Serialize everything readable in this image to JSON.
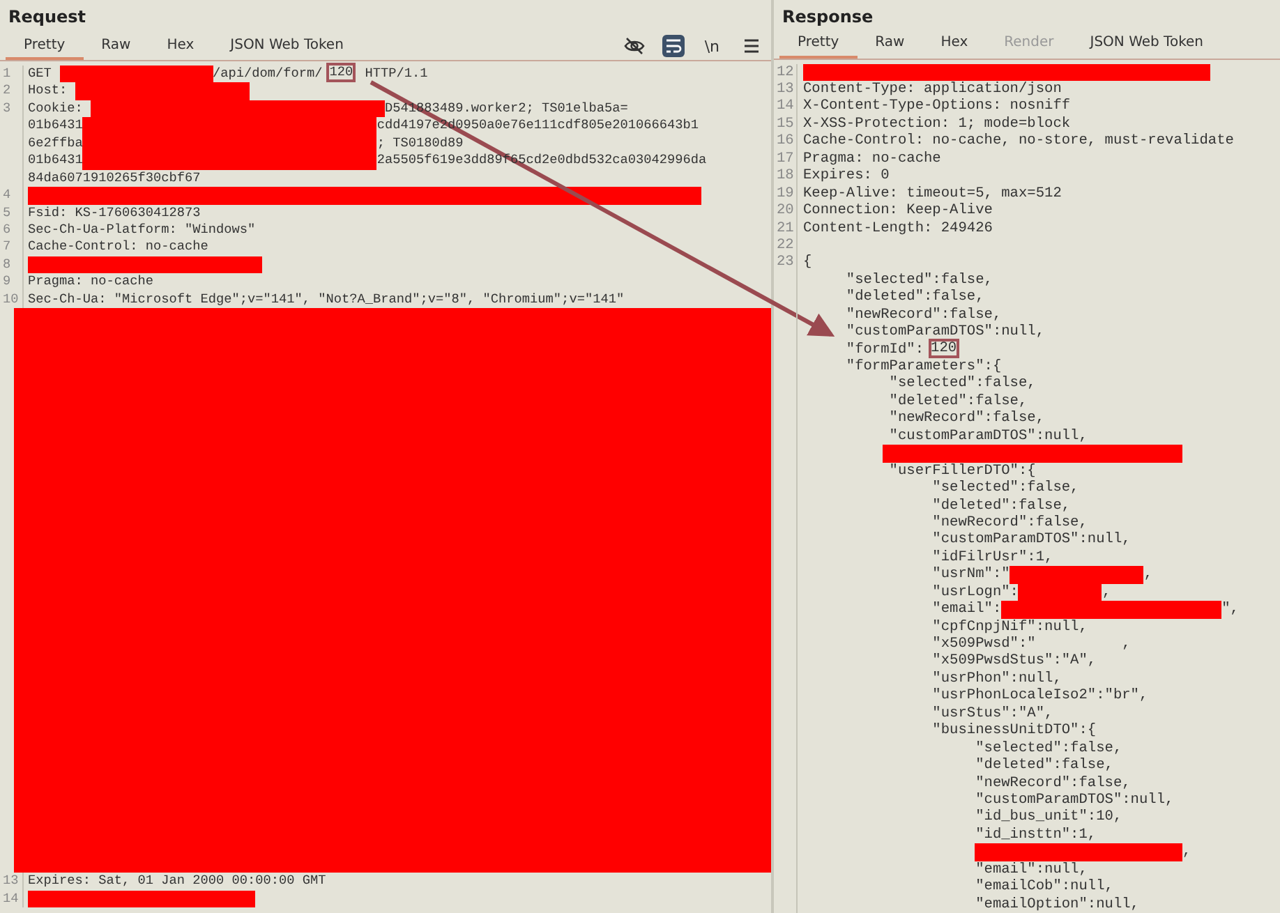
{
  "request": {
    "title": "Request",
    "tabs": [
      {
        "label": "Pretty",
        "selected": true,
        "disabled": false
      },
      {
        "label": "Raw",
        "selected": false,
        "disabled": false
      },
      {
        "label": "Hex",
        "selected": false,
        "disabled": false
      },
      {
        "label": "JSON Web Token",
        "selected": false,
        "disabled": false
      }
    ],
    "toolbar": {
      "wrap_on": true,
      "newline_label": "\\n"
    },
    "lines": [
      {
        "number": "1",
        "parts": [
          {
            "kind": "text",
            "text": "GET "
          },
          {
            "kind": "redaction"
          },
          {
            "kind": "text",
            "text": "/api/dom/form/"
          },
          {
            "kind": "highlight",
            "text": "120"
          },
          {
            "kind": "text",
            "text": " HTTP/1.1"
          }
        ]
      },
      {
        "number": "2",
        "parts": [
          {
            "kind": "text",
            "text": "Host: "
          },
          {
            "kind": "redaction"
          }
        ]
      },
      {
        "number": "3",
        "parts": [
          {
            "kind": "text",
            "text": "Cookie: "
          },
          {
            "kind": "redaction"
          },
          {
            "kind": "text",
            "text": "D541883489.worker2; TS01elba5a="
          }
        ]
      },
      {
        "parts": [
          {
            "kind": "text",
            "text": "01b6431"
          },
          {
            "kind": "redaction"
          },
          {
            "kind": "text",
            "text": "cdd4197e2d0950a0e76e111cdf805e201066643b1"
          }
        ]
      },
      {
        "parts": [
          {
            "kind": "text",
            "text": "6e2ffba"
          },
          {
            "kind": "redaction"
          },
          {
            "kind": "text",
            "text": "; TS0180d89"
          }
        ]
      },
      {
        "parts": [
          {
            "kind": "text",
            "text": "01b6431"
          },
          {
            "kind": "redaction"
          },
          {
            "kind": "text",
            "text": "2a5505f619e3dd89f65cd2e0dbd532ca03042996da"
          }
        ]
      },
      {
        "parts": [
          {
            "kind": "text",
            "text": "84da6071910265f30cbf67"
          }
        ]
      },
      {
        "number": "4",
        "parts": [
          {
            "kind": "redaction"
          }
        ]
      },
      {
        "number": "5",
        "parts": [
          {
            "kind": "text",
            "text": "Fsid: KS-1760630412873"
          }
        ]
      },
      {
        "number": "6",
        "parts": [
          {
            "kind": "text",
            "text": "Sec-Ch-Ua-Platform: \"Windows\""
          }
        ]
      },
      {
        "number": "7",
        "parts": [
          {
            "kind": "text",
            "text": "Cache-Control: no-cache"
          }
        ]
      },
      {
        "number": "8",
        "parts": [
          {
            "kind": "redaction"
          }
        ]
      },
      {
        "number": "9",
        "parts": [
          {
            "kind": "text",
            "text": "Pragma: no-cache"
          }
        ]
      },
      {
        "number": "10",
        "parts": [
          {
            "kind": "text",
            "text": "Sec-Ch-Ua: \"Microsoft Edge\";v=\"141\", \"Not?A_Brand\";v=\"8\", \"Chromium\";v=\"141\""
          }
        ]
      },
      {
        "parts": [
          {
            "kind": "block"
          }
        ]
      },
      {
        "number": "13",
        "parts": [
          {
            "kind": "text",
            "text": "Expires: Sat, 01 Jan 2000 00:00:00 GMT"
          }
        ]
      },
      {
        "number": "14",
        "parts": [
          {
            "kind": "redaction"
          }
        ]
      }
    ]
  },
  "response": {
    "title": "Response",
    "tabs": [
      {
        "label": "Pretty",
        "selected": true,
        "disabled": false
      },
      {
        "label": "Raw",
        "selected": false,
        "disabled": false
      },
      {
        "label": "Hex",
        "selected": false,
        "disabled": false
      },
      {
        "label": "Render",
        "selected": false,
        "disabled": true
      },
      {
        "label": "JSON Web Token",
        "selected": false,
        "disabled": false
      }
    ],
    "lines": [
      {
        "number": "12",
        "parts": [
          {
            "kind": "redaction"
          }
        ]
      },
      {
        "number": "13",
        "parts": [
          {
            "kind": "text",
            "text": "Content-Type: application/json"
          }
        ]
      },
      {
        "number": "14",
        "parts": [
          {
            "kind": "text",
            "text": "X-Content-Type-Options: nosniff"
          }
        ]
      },
      {
        "number": "15",
        "parts": [
          {
            "kind": "text",
            "text": "X-XSS-Protection: 1; mode=block"
          }
        ]
      },
      {
        "number": "16",
        "parts": [
          {
            "kind": "text",
            "text": "Cache-Control: no-cache, no-store, must-revalidate"
          }
        ]
      },
      {
        "number": "17",
        "parts": [
          {
            "kind": "text",
            "text": "Pragma: no-cache"
          }
        ]
      },
      {
        "number": "18",
        "parts": [
          {
            "kind": "text",
            "text": "Expires: 0"
          }
        ]
      },
      {
        "number": "19",
        "parts": [
          {
            "kind": "text",
            "text": "Keep-Alive: timeout=5, max=512"
          }
        ]
      },
      {
        "number": "20",
        "parts": [
          {
            "kind": "text",
            "text": "Connection: Keep-Alive"
          }
        ]
      },
      {
        "number": "21",
        "parts": [
          {
            "kind": "text",
            "text": "Content-Length: 249426"
          }
        ]
      },
      {
        "number": "22"
      },
      {
        "number": "23",
        "parts": [
          {
            "kind": "text",
            "text": "{"
          }
        ]
      },
      {
        "parts": [
          {
            "kind": "text",
            "text": "     \"selected\":false,"
          }
        ]
      },
      {
        "parts": [
          {
            "kind": "text",
            "text": "     \"deleted\":false,"
          }
        ]
      },
      {
        "parts": [
          {
            "kind": "text",
            "text": "     \"newRecord\":false,"
          }
        ]
      },
      {
        "parts": [
          {
            "kind": "text",
            "text": "     \"customParamDTOS\":null,"
          }
        ]
      },
      {
        "parts": [
          {
            "kind": "text",
            "text": "     \"formId\":"
          },
          {
            "kind": "highlight",
            "text": "120"
          }
        ]
      },
      {
        "parts": [
          {
            "kind": "text",
            "text": "     \"formParameters\":{"
          }
        ]
      },
      {
        "parts": [
          {
            "kind": "text",
            "text": "          \"selected\":false,"
          }
        ]
      },
      {
        "parts": [
          {
            "kind": "text",
            "text": "          \"deleted\":false,"
          }
        ]
      },
      {
        "parts": [
          {
            "kind": "text",
            "text": "          \"newRecord\":false,"
          }
        ]
      },
      {
        "parts": [
          {
            "kind": "text",
            "text": "          \"customParamDTOS\":null,"
          }
        ]
      },
      {
        "parts": [
          {
            "kind": "redaction"
          }
        ]
      },
      {
        "parts": [
          {
            "kind": "text",
            "text": "          \"userFillerDTO\":{"
          }
        ]
      },
      {
        "parts": [
          {
            "kind": "text",
            "text": "               \"selected\":false,"
          }
        ]
      },
      {
        "parts": [
          {
            "kind": "text",
            "text": "               \"deleted\":false,"
          }
        ]
      },
      {
        "parts": [
          {
            "kind": "text",
            "text": "               \"newRecord\":false,"
          }
        ]
      },
      {
        "parts": [
          {
            "kind": "text",
            "text": "               \"customParamDTOS\":null,"
          }
        ]
      },
      {
        "parts": [
          {
            "kind": "text",
            "text": "               \"idFilrUsr\":1,"
          }
        ]
      },
      {
        "parts": [
          {
            "kind": "text",
            "text": "               \"usrNm\":\""
          },
          {
            "kind": "redaction"
          },
          {
            "kind": "text",
            "text": ","
          }
        ]
      },
      {
        "parts": [
          {
            "kind": "text",
            "text": "               \"usrLogn\":"
          },
          {
            "kind": "redaction"
          },
          {
            "kind": "text",
            "text": ","
          }
        ]
      },
      {
        "parts": [
          {
            "kind": "text",
            "text": "               \"email\":"
          },
          {
            "kind": "redaction"
          },
          {
            "kind": "text",
            "text": "\","
          }
        ]
      },
      {
        "parts": [
          {
            "kind": "text",
            "text": "               \"cpfCnpjNif\":null,"
          }
        ]
      },
      {
        "parts": [
          {
            "kind": "text",
            "text": "               \"x509Pwsd\":\"          ,"
          }
        ]
      },
      {
        "parts": [
          {
            "kind": "text",
            "text": "               \"x509PwsdStus\":\"A\","
          }
        ]
      },
      {
        "parts": [
          {
            "kind": "text",
            "text": "               \"usrPhon\":null,"
          }
        ]
      },
      {
        "parts": [
          {
            "kind": "text",
            "text": "               \"usrPhonLocaleIso2\":\"br\","
          }
        ]
      },
      {
        "parts": [
          {
            "kind": "text",
            "text": "               \"usrStus\":\"A\","
          }
        ]
      },
      {
        "parts": [
          {
            "kind": "text",
            "text": "               \"businessUnitDTO\":{"
          }
        ]
      },
      {
        "parts": [
          {
            "kind": "text",
            "text": "                    \"selected\":false,"
          }
        ]
      },
      {
        "parts": [
          {
            "kind": "text",
            "text": "                    \"deleted\":false,"
          }
        ]
      },
      {
        "parts": [
          {
            "kind": "text",
            "text": "                    \"newRecord\":false,"
          }
        ]
      },
      {
        "parts": [
          {
            "kind": "text",
            "text": "                    \"customParamDTOS\":null,"
          }
        ]
      },
      {
        "parts": [
          {
            "kind": "text",
            "text": "                    \"id_bus_unit\":10,"
          }
        ]
      },
      {
        "parts": [
          {
            "kind": "text",
            "text": "                    \"id_insttn\":1,"
          }
        ]
      },
      {
        "parts": [
          {
            "kind": "redaction"
          },
          {
            "kind": "text",
            "text": ","
          }
        ]
      },
      {
        "parts": [
          {
            "kind": "text",
            "text": "                    \"email\":null,"
          }
        ]
      },
      {
        "parts": [
          {
            "kind": "text",
            "text": "                    \"emailCob\":null,"
          }
        ]
      },
      {
        "parts": [
          {
            "kind": "text",
            "text": "                    \"emailOption\":null,"
          }
        ]
      }
    ]
  }
}
